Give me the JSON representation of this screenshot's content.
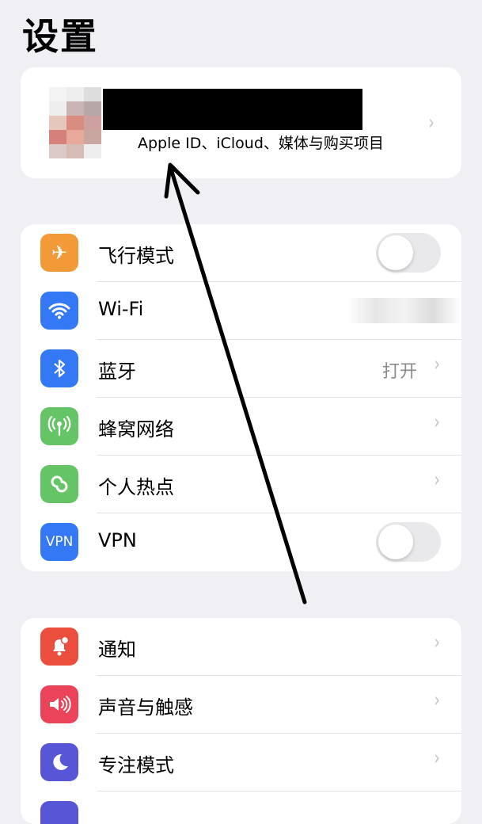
{
  "header": {
    "title": "设置"
  },
  "profile": {
    "subtitle": "Apple ID、iCloud、媒体与购买项目"
  },
  "group1": [
    {
      "label": "飞行模式",
      "icon": "airplane-icon",
      "color": "#f19a37",
      "control": "toggle",
      "on": false
    },
    {
      "label": "Wi-Fi",
      "icon": "wifi-icon",
      "color": "#3478f6",
      "control": "value"
    },
    {
      "label": "蓝牙",
      "icon": "bluetooth-icon",
      "color": "#3478f6",
      "value": "打开",
      "control": "chevron"
    },
    {
      "label": "蜂窝网络",
      "icon": "cellular-icon",
      "color": "#65c466",
      "control": "chevron"
    },
    {
      "label": "个人热点",
      "icon": "hotspot-icon",
      "color": "#65c466",
      "control": "chevron"
    },
    {
      "label": "VPN",
      "icon": "vpn-icon",
      "icon_text": "VPN",
      "color": "#3478f6",
      "control": "toggle",
      "on": false
    }
  ],
  "group2": [
    {
      "label": "通知",
      "icon": "notification-icon",
      "color": "#eb4e3d"
    },
    {
      "label": "声音与触感",
      "icon": "sound-icon",
      "color": "#eb445a"
    },
    {
      "label": "专注模式",
      "icon": "moon-icon",
      "color": "#5856d6"
    },
    {
      "label": "",
      "icon": "screen-time-icon",
      "color": "#5856d6"
    }
  ]
}
